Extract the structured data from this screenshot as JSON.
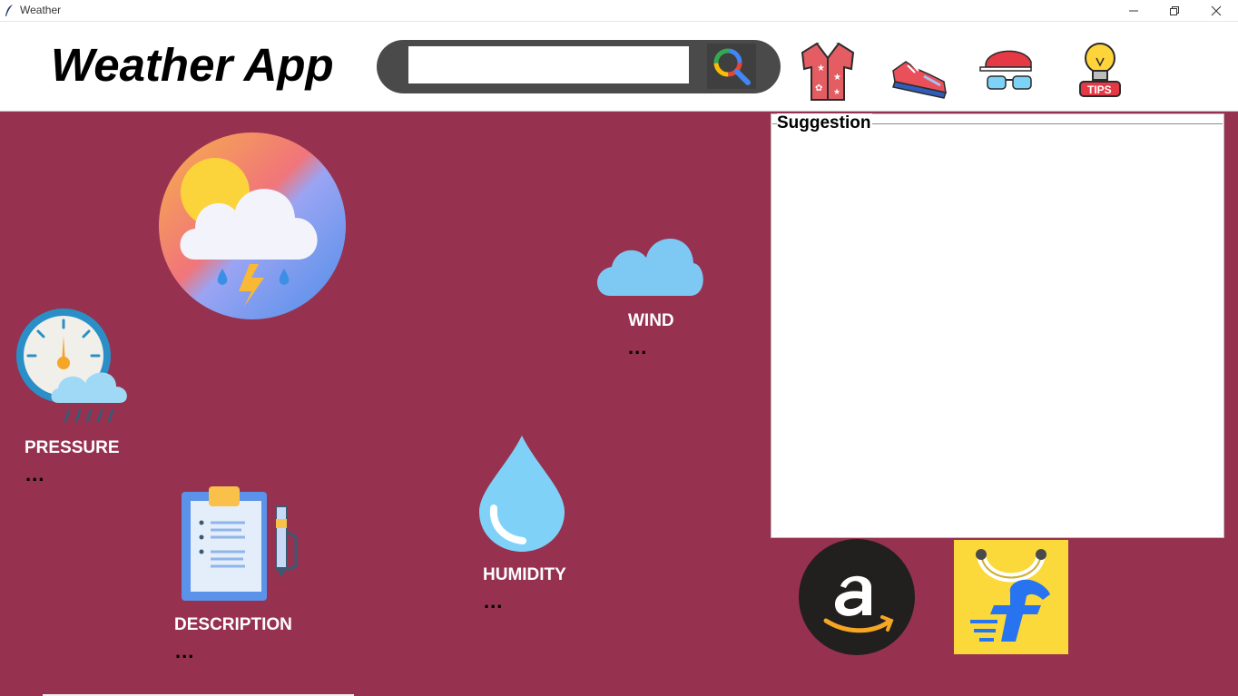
{
  "window": {
    "title": "Weather"
  },
  "header": {
    "app_title": "Weather App",
    "search": {
      "value": "",
      "placeholder": ""
    },
    "icons": [
      "clothes-shirt-icon",
      "shoes-icon",
      "accessories-cap-glasses-icon",
      "tips-bulb-icon"
    ],
    "tips_label": "TIPS"
  },
  "weather": {
    "wind": {
      "label": "WIND",
      "value": "..."
    },
    "pressure": {
      "label": "PRESSURE",
      "value": "..."
    },
    "humidity": {
      "label": "HUMIDITY",
      "value": "..."
    },
    "description": {
      "label": "DESCRIPTION",
      "value": "..."
    }
  },
  "suggestion": {
    "title": "Suggestion",
    "content": ""
  },
  "shops": [
    "amazon-logo",
    "flipkart-logo"
  ],
  "colors": {
    "background": "#963250",
    "header_bg": "#ffffff",
    "search_bar": "#4a4a4a",
    "label": "#ffffff",
    "value": "#000000"
  }
}
